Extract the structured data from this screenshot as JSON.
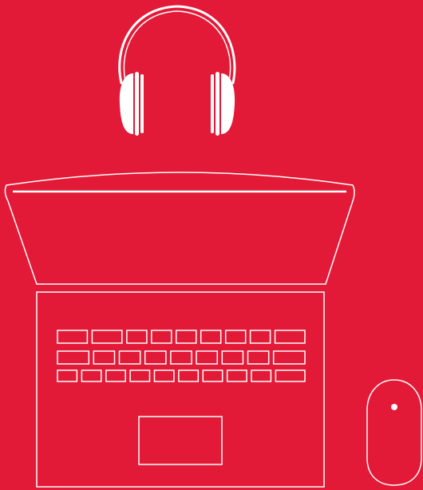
{
  "colors": {
    "background": "#E31A37",
    "line": "#FFFFFF"
  },
  "illustration": {
    "objects": [
      "headphones-icon",
      "laptop-icon",
      "mouse-icon"
    ]
  },
  "keyboard": {
    "rows": [
      [
        "wide",
        "wide",
        "key",
        "key",
        "key",
        "key",
        "key",
        "key",
        "wide"
      ],
      [
        "wide",
        "key",
        "key",
        "key",
        "key",
        "key",
        "key",
        "key",
        "wide"
      ],
      [
        "key",
        "key",
        "key",
        "key",
        "key",
        "key",
        "key",
        "key",
        "key",
        "wide"
      ]
    ]
  }
}
